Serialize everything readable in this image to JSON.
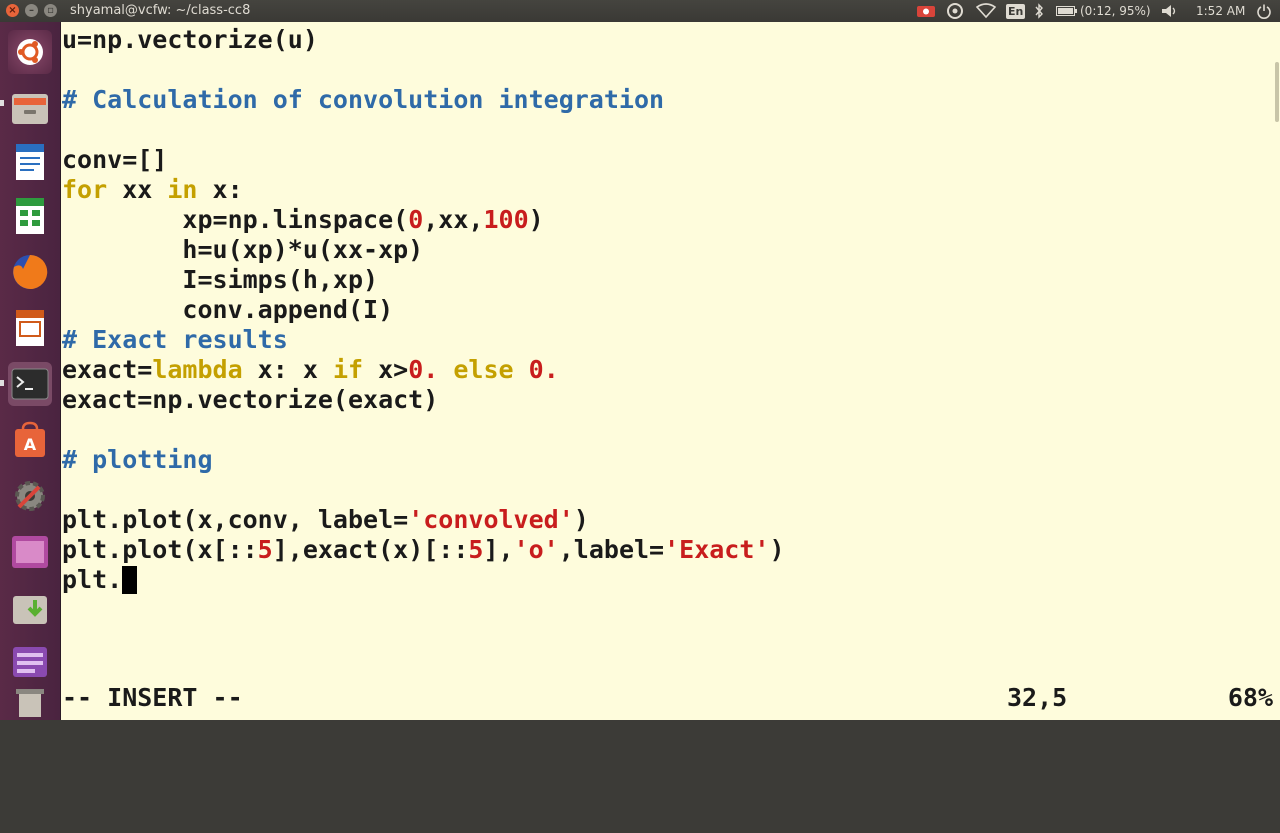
{
  "window": {
    "title": "shyamal@vcfw: ~/class-cc8"
  },
  "tray": {
    "keyboard": "En",
    "battery": "(0:12, 95%)",
    "clock": "1:52 AM"
  },
  "launcher": {
    "items": [
      "dash-home",
      "files",
      "writer",
      "calc",
      "firefox",
      "impress",
      "terminal",
      "software-center",
      "system-settings",
      "workspace-switcher",
      "downloads-folder",
      "stacer",
      "trash"
    ]
  },
  "editor": {
    "lines": [
      "u=np.vectorize(u)",
      "",
      "# Calculation of convolution integration",
      "",
      "conv=[]",
      "for xx in x:",
      "        xp=np.linspace(0,xx,100)",
      "        h=u(xp)*u(xx-xp)",
      "        I=simps(h,xp)",
      "        conv.append(I)",
      "# Exact results",
      "exact=lambda x: x if x>0. else 0.",
      "exact=np.vectorize(exact)",
      "",
      "# plotting",
      "",
      "plt.plot(x,conv, label='convolved')",
      "plt.plot(x[::5],exact(x)[::5],'o',label='Exact')",
      "plt."
    ],
    "mode": "-- INSERT --",
    "position": "32,5",
    "percent": "68%"
  },
  "colors": {
    "background": "#fefcdc",
    "comment": "#2f6aa8",
    "keyword": "#c4a000",
    "number_string": "#c81d1d",
    "launcher": "#5a2a47"
  }
}
